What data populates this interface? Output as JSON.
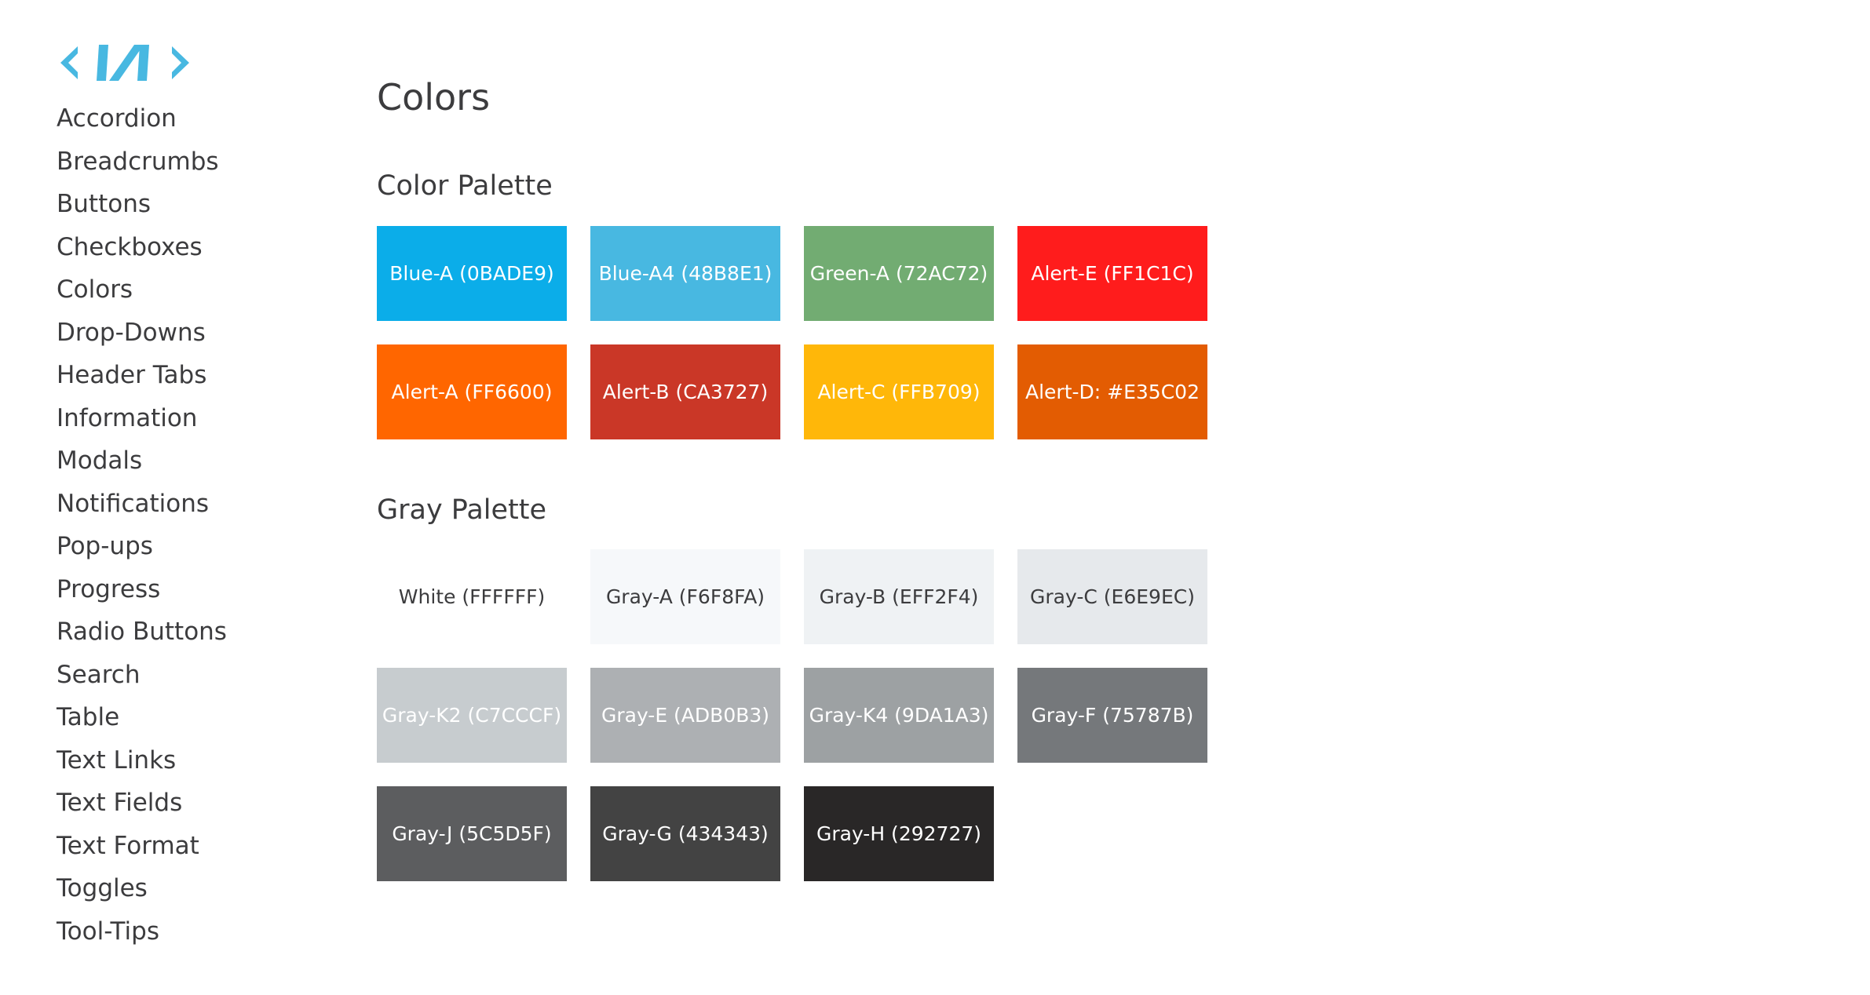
{
  "sidebar": {
    "items": [
      {
        "label": "Accordion"
      },
      {
        "label": "Breadcrumbs"
      },
      {
        "label": "Buttons"
      },
      {
        "label": "Checkboxes"
      },
      {
        "label": "Colors"
      },
      {
        "label": "Drop-Downs"
      },
      {
        "label": "Header Tabs"
      },
      {
        "label": "Information"
      },
      {
        "label": "Modals"
      },
      {
        "label": "Notifications"
      },
      {
        "label": "Pop-ups"
      },
      {
        "label": "Progress"
      },
      {
        "label": "Radio Buttons"
      },
      {
        "label": "Search"
      },
      {
        "label": "Table"
      },
      {
        "label": "Text Links"
      },
      {
        "label": "Text Fields"
      },
      {
        "label": "Text Format"
      },
      {
        "label": "Toggles"
      },
      {
        "label": "Tool-Tips"
      }
    ]
  },
  "logo": {
    "icon": "va-logo-icon",
    "color": "#48B8E1"
  },
  "main": {
    "title": "Colors",
    "color_palette": {
      "title": "Color Palette",
      "swatches": [
        {
          "label": "Blue-A (0BADE9)",
          "bg": "#0BADE9",
          "fg": "#FFFFFF"
        },
        {
          "label": "Blue-A4 (48B8E1)",
          "bg": "#48B8E1",
          "fg": "#FFFFFF"
        },
        {
          "label": "Green-A (72AC72)",
          "bg": "#72AC72",
          "fg": "#FFFFFF"
        },
        {
          "label": "Alert-E (FF1C1C)",
          "bg": "#FF1C1C",
          "fg": "#FFFFFF"
        },
        {
          "label": "Alert-A (FF6600)",
          "bg": "#FF6600",
          "fg": "#FFFFFF"
        },
        {
          "label": "Alert-B (CA3727)",
          "bg": "#CA3727",
          "fg": "#FFFFFF"
        },
        {
          "label": "Alert-C (FFB709)",
          "bg": "#FFB709",
          "fg": "#FFFFFF"
        },
        {
          "label": "Alert-D: #E35C02",
          "bg": "#E35C02",
          "fg": "#FFFFFF"
        }
      ]
    },
    "gray_palette": {
      "title": "Gray Palette",
      "swatches": [
        {
          "label": "White (FFFFFF)",
          "bg": "#FFFFFF",
          "fg": "#3C3C3E"
        },
        {
          "label": "Gray-A (F6F8FA)",
          "bg": "#F6F8FA",
          "fg": "#3C3C3E"
        },
        {
          "label": "Gray-B (EFF2F4)",
          "bg": "#EFF2F4",
          "fg": "#3C3C3E"
        },
        {
          "label": "Gray-C (E6E9EC)",
          "bg": "#E6E9EC",
          "fg": "#3C3C3E"
        },
        {
          "label": "Gray-K2 (C7CCCF)",
          "bg": "#C7CCCF",
          "fg": "#FFFFFF"
        },
        {
          "label": "Gray-E (ADB0B3)",
          "bg": "#ADB0B3",
          "fg": "#FFFFFF"
        },
        {
          "label": "Gray-K4 (9DA1A3)",
          "bg": "#9DA1A3",
          "fg": "#FFFFFF"
        },
        {
          "label": "Gray-F (75787B)",
          "bg": "#75787B",
          "fg": "#FFFFFF"
        },
        {
          "label": "Gray-J (5C5D5F)",
          "bg": "#5C5D5F",
          "fg": "#FFFFFF"
        },
        {
          "label": "Gray-G (434343)",
          "bg": "#434343",
          "fg": "#FFFFFF"
        },
        {
          "label": "Gray-H (292727)",
          "bg": "#292727",
          "fg": "#FFFFFF"
        }
      ]
    }
  }
}
